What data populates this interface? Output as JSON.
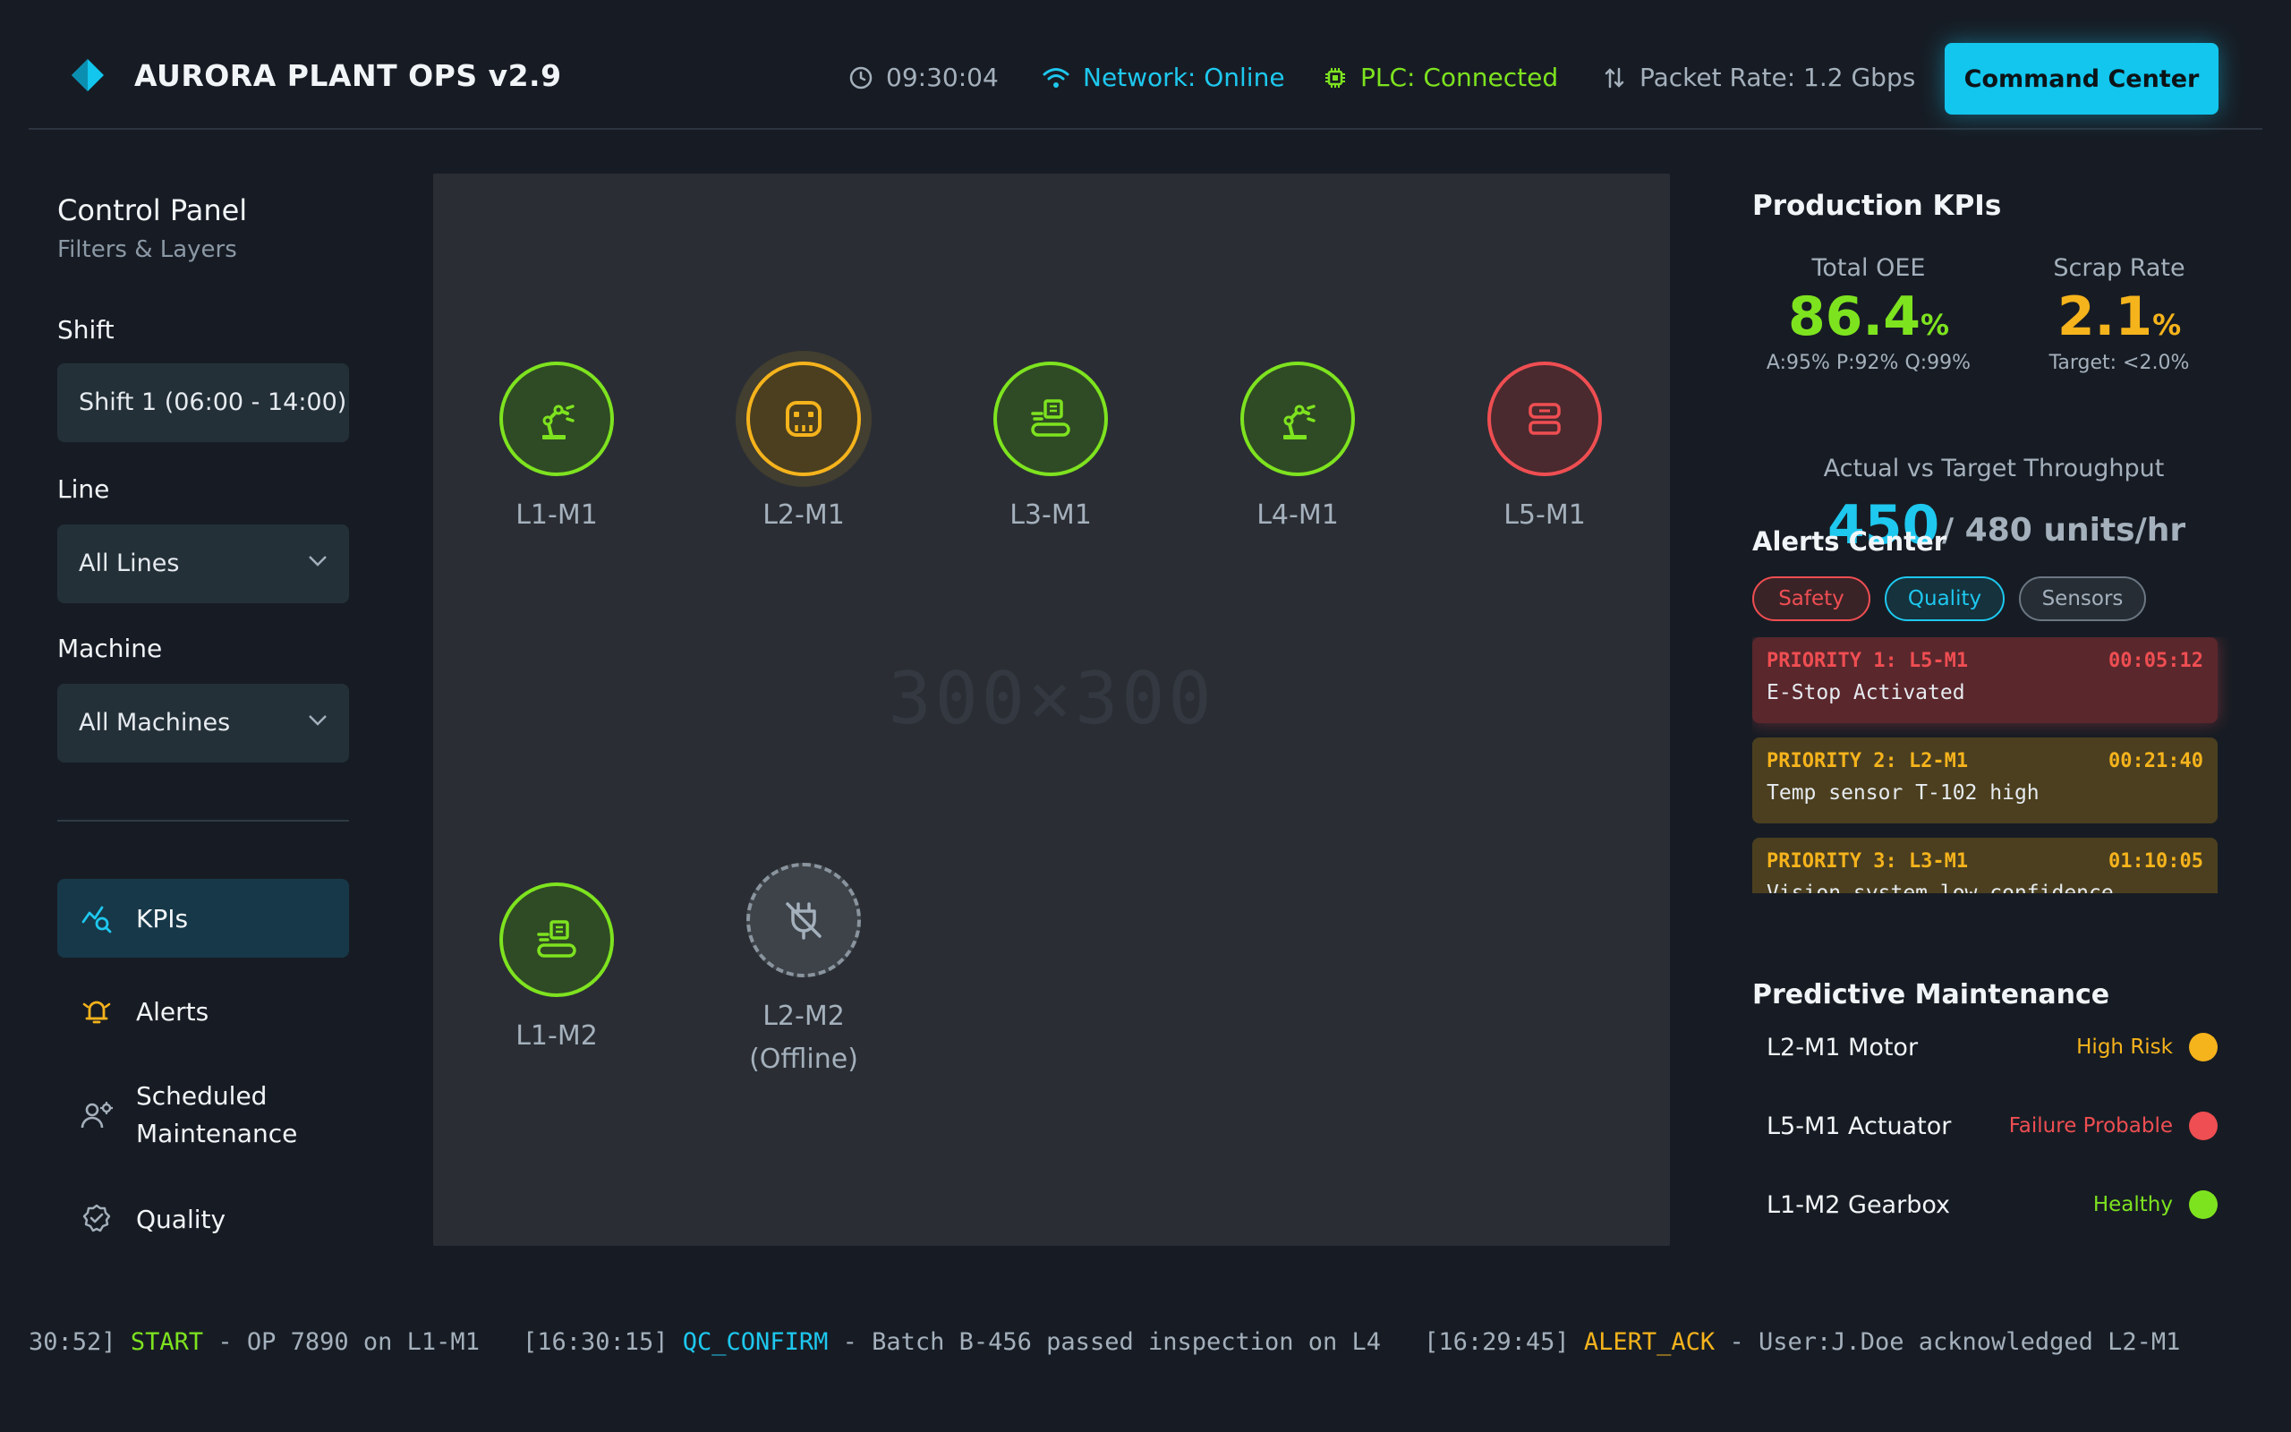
{
  "header": {
    "app_title": "AURORA PLANT OPS v2.9",
    "clock": "09:30:04",
    "network": "Network: Online",
    "plc": "PLC: Connected",
    "packet_rate": "Packet Rate: 1.2 Gbps",
    "command_button": "Command Center"
  },
  "left_panel": {
    "title": "Control Panel",
    "subtitle": "Filters & Layers",
    "filters": {
      "shift_label": "Shift",
      "shift_value": "Shift 1 (06:00 - 14:00)",
      "line_label": "Line",
      "line_value": "All Lines",
      "machine_label": "Machine",
      "machine_value": "All Machines"
    },
    "nav": [
      {
        "label": "KPIs",
        "icon": "chart-search-icon",
        "active": true
      },
      {
        "label": "Alerts",
        "icon": "alarm-bell-icon",
        "active": false
      },
      {
        "label": "Scheduled Maintenance",
        "icon": "technician-gear-icon",
        "active": false
      },
      {
        "label": "Quality",
        "icon": "badge-check-icon",
        "active": false
      }
    ]
  },
  "map": {
    "placeholder": "300×300",
    "machines": [
      {
        "label": "L1-M1",
        "status": "ok",
        "icon": "robot-arm-icon"
      },
      {
        "label": "L2-M1",
        "status": "warning",
        "icon": "robot-face-icon"
      },
      {
        "label": "L3-M1",
        "status": "ok",
        "icon": "conveyor-icon"
      },
      {
        "label": "L4-M1",
        "status": "ok",
        "icon": "robot-arm-icon"
      },
      {
        "label": "L5-M1",
        "status": "critical",
        "icon": "robot-face-icon"
      },
      {
        "label": "L1-M2",
        "status": "ok",
        "icon": "conveyor-icon"
      },
      {
        "label": "L2-M2",
        "sub_label": "(Offline)",
        "status": "offline",
        "icon": "plug-off-icon"
      }
    ]
  },
  "kpis": {
    "title": "Production KPIs",
    "oee": {
      "label": "Total OEE",
      "value": "86.4",
      "unit": "%",
      "sub": "A:95% P:92% Q:99%"
    },
    "scrap": {
      "label": "Scrap Rate",
      "value": "2.1",
      "unit": "%",
      "sub": "Target: <2.0%"
    },
    "throughput": {
      "label": "Actual vs Target Throughput",
      "actual": "450",
      "target": "/ 480 units/hr"
    }
  },
  "alerts": {
    "title": "Alerts Center",
    "filters": [
      "Safety",
      "Quality",
      "Sensors"
    ],
    "items": [
      {
        "priority": "PRIORITY 1: L5-M1",
        "time": "00:05:12",
        "message": "E-Stop Activated"
      },
      {
        "priority": "PRIORITY 2: L2-M1",
        "time": "00:21:40",
        "message": "Temp sensor T-102 high"
      },
      {
        "priority": "PRIORITY 3: L3-M1",
        "time": "01:10:05",
        "message": "Vision system low confidence"
      }
    ]
  },
  "maintenance": {
    "title": "Predictive Maintenance",
    "items": [
      {
        "name": "L2-M1 Motor",
        "status": "High Risk",
        "color": "#f5b31c"
      },
      {
        "name": "L5-M1 Actuator",
        "status": "Failure Probable",
        "color": "#ef4e52"
      },
      {
        "name": "L1-M2 Gearbox",
        "status": "Healthy",
        "color": "#7ee31f"
      }
    ]
  },
  "ticker": [
    {
      "time": "30:52]",
      "event": "START",
      "text": " - OP 7890 on L1-M1"
    },
    {
      "time": "[16:30:15]",
      "event": "QC_CONFIRM",
      "text": " - Batch B-456 passed inspection on L4"
    },
    {
      "time": "[16:29:45]",
      "event": "ALERT_ACK",
      "text": " - User:J.Doe acknowledged L2-M1"
    }
  ],
  "colors": {
    "accent": "#12c6ee",
    "ok": "#7ee31f",
    "warning": "#f5b31c",
    "critical": "#ef4e52",
    "offline": "#8a949e"
  }
}
